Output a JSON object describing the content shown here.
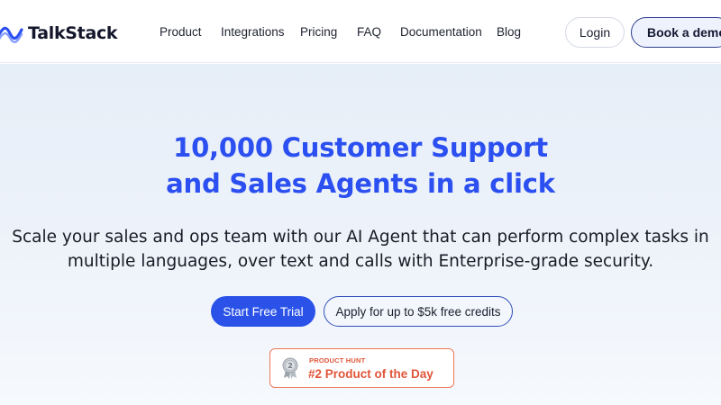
{
  "brand": {
    "name": "TalkStack",
    "accent": "#2b4ff0"
  },
  "nav": {
    "items": [
      {
        "label": "Product"
      },
      {
        "label": "Integrations"
      },
      {
        "label": "Pricing"
      },
      {
        "label": "FAQ"
      },
      {
        "label": "Documentation"
      },
      {
        "label": "Blog"
      }
    ],
    "login_label": "Login",
    "demo_label": "Book a demo"
  },
  "hero": {
    "title_line1": "10,000 Customer Support",
    "title_line2": "and Sales Agents in a click",
    "subtitle_line1": "Scale your sales and ops team with our AI Agent that can perform complex tasks in",
    "subtitle_line2": "multiple languages, over text and calls with Enterprise-grade security.",
    "primary_cta": "Start Free Trial",
    "secondary_cta": "Apply for up to $5k free credits"
  },
  "badge": {
    "kicker": "PRODUCT HUNT",
    "title": "#2 Product of the Day",
    "medal_number": "2",
    "color": "#e0553a"
  }
}
